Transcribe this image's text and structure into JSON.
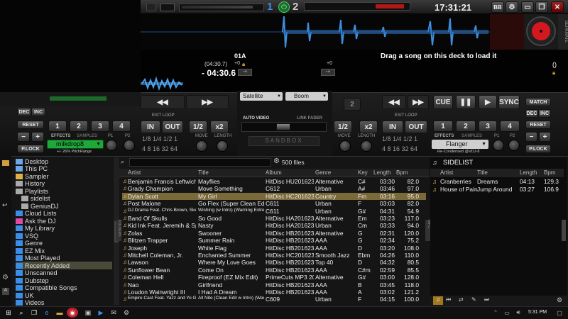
{
  "top": {
    "deck1_number": "1",
    "deck2_number": "2",
    "clock": "17:31:21",
    "bb_label": "BB"
  },
  "deck_left": {
    "bpm_label": "01A",
    "time_total": "(04:30.7)",
    "pitch": "+0",
    "time_remaining": "- 04:30.6",
    "exit_loop": "EXIT LOOP",
    "pitch_range_note": "+/- 26% PitchRange",
    "effects_label": "EFFECTS",
    "samples_label": "SAMPLES",
    "effect_name": "milkdrop8",
    "p1": "P1",
    "p2": "P2",
    "buttons": {
      "cue": "CUE",
      "in": "IN",
      "out": "OUT",
      "half": "1/2",
      "double": "x2",
      "loop_sizes": "1/8 1/4 1/2 1",
      "loop_sizes2": "4 8 16 32 64",
      "move": "MOVE",
      "length": "LENGTH",
      "match": "MATCH",
      "dec": "DEC",
      "inc": "INC",
      "reset": "RESET",
      "plock": "P.LOCK",
      "hotcues": [
        "1",
        "2",
        "3",
        "4"
      ]
    }
  },
  "deck_right": {
    "load_prompt": "Drag a song on this deck to load it",
    "pitch": "+0",
    "time_remaining": "()",
    "exit_loop": "EXIT LOOP",
    "effects_label": "EFFECTS",
    "samples_label": "SAMPLES",
    "effect_name": "Flanger",
    "credit": "Re-Condensed @VDJ-8",
    "p1": "P1",
    "p2": "P2",
    "buttons": {
      "cue": "CUE",
      "play": "▶",
      "pause": "❚❚",
      "sync": "SYNC",
      "in": "IN",
      "out": "OUT",
      "half": "1/2",
      "double": "x2",
      "loop_sizes": "1/8 1/4 1/2 1",
      "loop_sizes2": "4 8 16 32 64",
      "move": "MOVE",
      "length": "LENGTH",
      "match": "MATCH",
      "dec": "DEC",
      "inc": "INC",
      "reset": "RESET",
      "plock": "P.LOCK",
      "hotcues": [
        "1",
        "2",
        "3",
        "4"
      ]
    }
  },
  "center": {
    "video_source": "Satellite",
    "effect": "Boom",
    "auto_video": "AUTO VIDEO",
    "link_fader": "LINK FADER",
    "sandbox": "SANDBOX",
    "deck_number": "2"
  },
  "browser": {
    "file_count": "500 files",
    "folders": [
      {
        "label": "Desktop",
        "color": "#6aa6e8"
      },
      {
        "label": "This PC",
        "color": "#6aa6e8"
      },
      {
        "label": "Sampler",
        "color": "#e0b040"
      },
      {
        "label": "History",
        "color": "#aaaaaa"
      },
      {
        "label": "Playlists",
        "color": "#aaaaaa"
      },
      {
        "label": "sidelist",
        "color": "#aaaaaa"
      },
      {
        "label": "GeniusDJ",
        "color": "#aaaaaa"
      },
      {
        "label": "Cloud Lists",
        "color": "#3a8ee8"
      },
      {
        "label": "Ask the DJ",
        "color": "#e04aa0"
      },
      {
        "label": "My Library",
        "color": "#3a8ee8"
      },
      {
        "label": "VSQ",
        "color": "#3a8ee8"
      },
      {
        "label": "Genre",
        "color": "#3a8ee8"
      },
      {
        "label": "EZ Mix",
        "color": "#3a8ee8"
      },
      {
        "label": "Most Played",
        "color": "#3a8ee8"
      },
      {
        "label": "Recently Added",
        "color": "#3a8ee8"
      },
      {
        "label": "Unscanned",
        "color": "#3a8ee8"
      },
      {
        "label": "Dubstep",
        "color": "#3a8ee8"
      },
      {
        "label": "Compatible Songs",
        "color": "#3a8ee8"
      },
      {
        "label": "UK",
        "color": "#3a8ee8"
      },
      {
        "label": "Videos",
        "color": "#3a8ee8"
      }
    ],
    "columns": [
      "Artist",
      "Title",
      "Album",
      "Genre",
      "Key",
      "Length",
      "Bpm"
    ],
    "rows": [
      [
        "Benjamin Francis Leftwich",
        "Mayflies",
        "HitDisc HU201623",
        "Alternative",
        "C#",
        "03:30",
        "82.0"
      ],
      [
        "Grady Champion",
        "Move Something",
        "C612",
        "Urban",
        "A#",
        "03:46",
        "97.0"
      ],
      [
        "Dylan Scott",
        "My Girl",
        "HitDisc HC201623",
        "Country",
        "Fm",
        "03:16",
        "95.0"
      ],
      [
        "Post Malone",
        "Go Flex (Super Clean Edit)",
        "C611",
        "Urban",
        "F",
        "03:03",
        "82.0"
      ],
      [
        "DJ Drama Feat. Chris Brown, Ske...",
        "Wishing (w Intro) (Warning Extren...",
        "C611",
        "Urban",
        "G#",
        "04:31",
        "54.9"
      ],
      [
        "Band Of Skulls",
        "So Good",
        "HitDisc HA201623",
        "Alternative",
        "Em",
        "03:23",
        "117.0"
      ],
      [
        "Kid Ink Feat. Jeremih & Spice",
        "Nasty",
        "HitDisc HA201623",
        "Urban",
        "Cm",
        "03:33",
        "94.0"
      ],
      [
        "Zolas",
        "Swooner",
        "HitDisc HB201623",
        "Alternative",
        "G",
        "02:31",
        "120.0"
      ],
      [
        "Blitzen Trapper",
        "Summer Rain",
        "HitDisc HB201623",
        "AAA",
        "G",
        "02:34",
        "75.2"
      ],
      [
        "Joseph",
        "White Flag",
        "HitDisc HB201623",
        "AAA",
        "D",
        "03:20",
        "108.0"
      ],
      [
        "Mitchell Coleman, Jr.",
        "Enchanted Summer",
        "HitDisc HC201623",
        "Smooth Jazz",
        "Ebm",
        "04:26",
        "110.0"
      ],
      [
        "Lawson",
        "Where My Love Goes",
        "HitDisc HB201623",
        "Top 40",
        "D",
        "04:32",
        "80.5"
      ],
      [
        "Sunflower Bean",
        "Come On",
        "HitDisc HB201623",
        "AAA",
        "C#m",
        "02:59",
        "85.5"
      ],
      [
        "Coleman Hell",
        "Fireproof (EZ Mix Edit)",
        "PrimeCuts MP3 201623",
        "Alternative",
        "G#",
        "03:00",
        "128.0"
      ],
      [
        "Nao",
        "Girlfriend",
        "HitDisc HB201623",
        "AAA",
        "B",
        "03:45",
        "118.0"
      ],
      [
        "Loudon Wainwright III",
        "I Had A Dream",
        "HitDisc HB201623",
        "AAA",
        "A",
        "03:02",
        "121.2"
      ],
      [
        "Empire Cast Feat. Yazz and Yo G...",
        "All Nite (Clean Edit w Intro) (Warn...",
        "C609",
        "Urban",
        "F",
        "04:15",
        "100.0"
      ]
    ],
    "highlighted_row": 2
  },
  "sidelist": {
    "title": "SIDELIST",
    "columns": [
      "Artist",
      "Title",
      "Length",
      "Bpm"
    ],
    "rows": [
      [
        "Cranberries",
        "Dreams",
        "04:13",
        "129.3"
      ],
      [
        "House of Pain",
        "Jump Around",
        "03:27",
        "106.9"
      ]
    ]
  },
  "taskbar": {
    "time": "5:31 PM"
  },
  "colors": {
    "accent_blue": "#3a8ee8",
    "wave_blue": "#3d8fe0",
    "highlight_row": "#7a6a3a",
    "green_effect": "#1ea83a",
    "red_turntable": "#d41820"
  }
}
